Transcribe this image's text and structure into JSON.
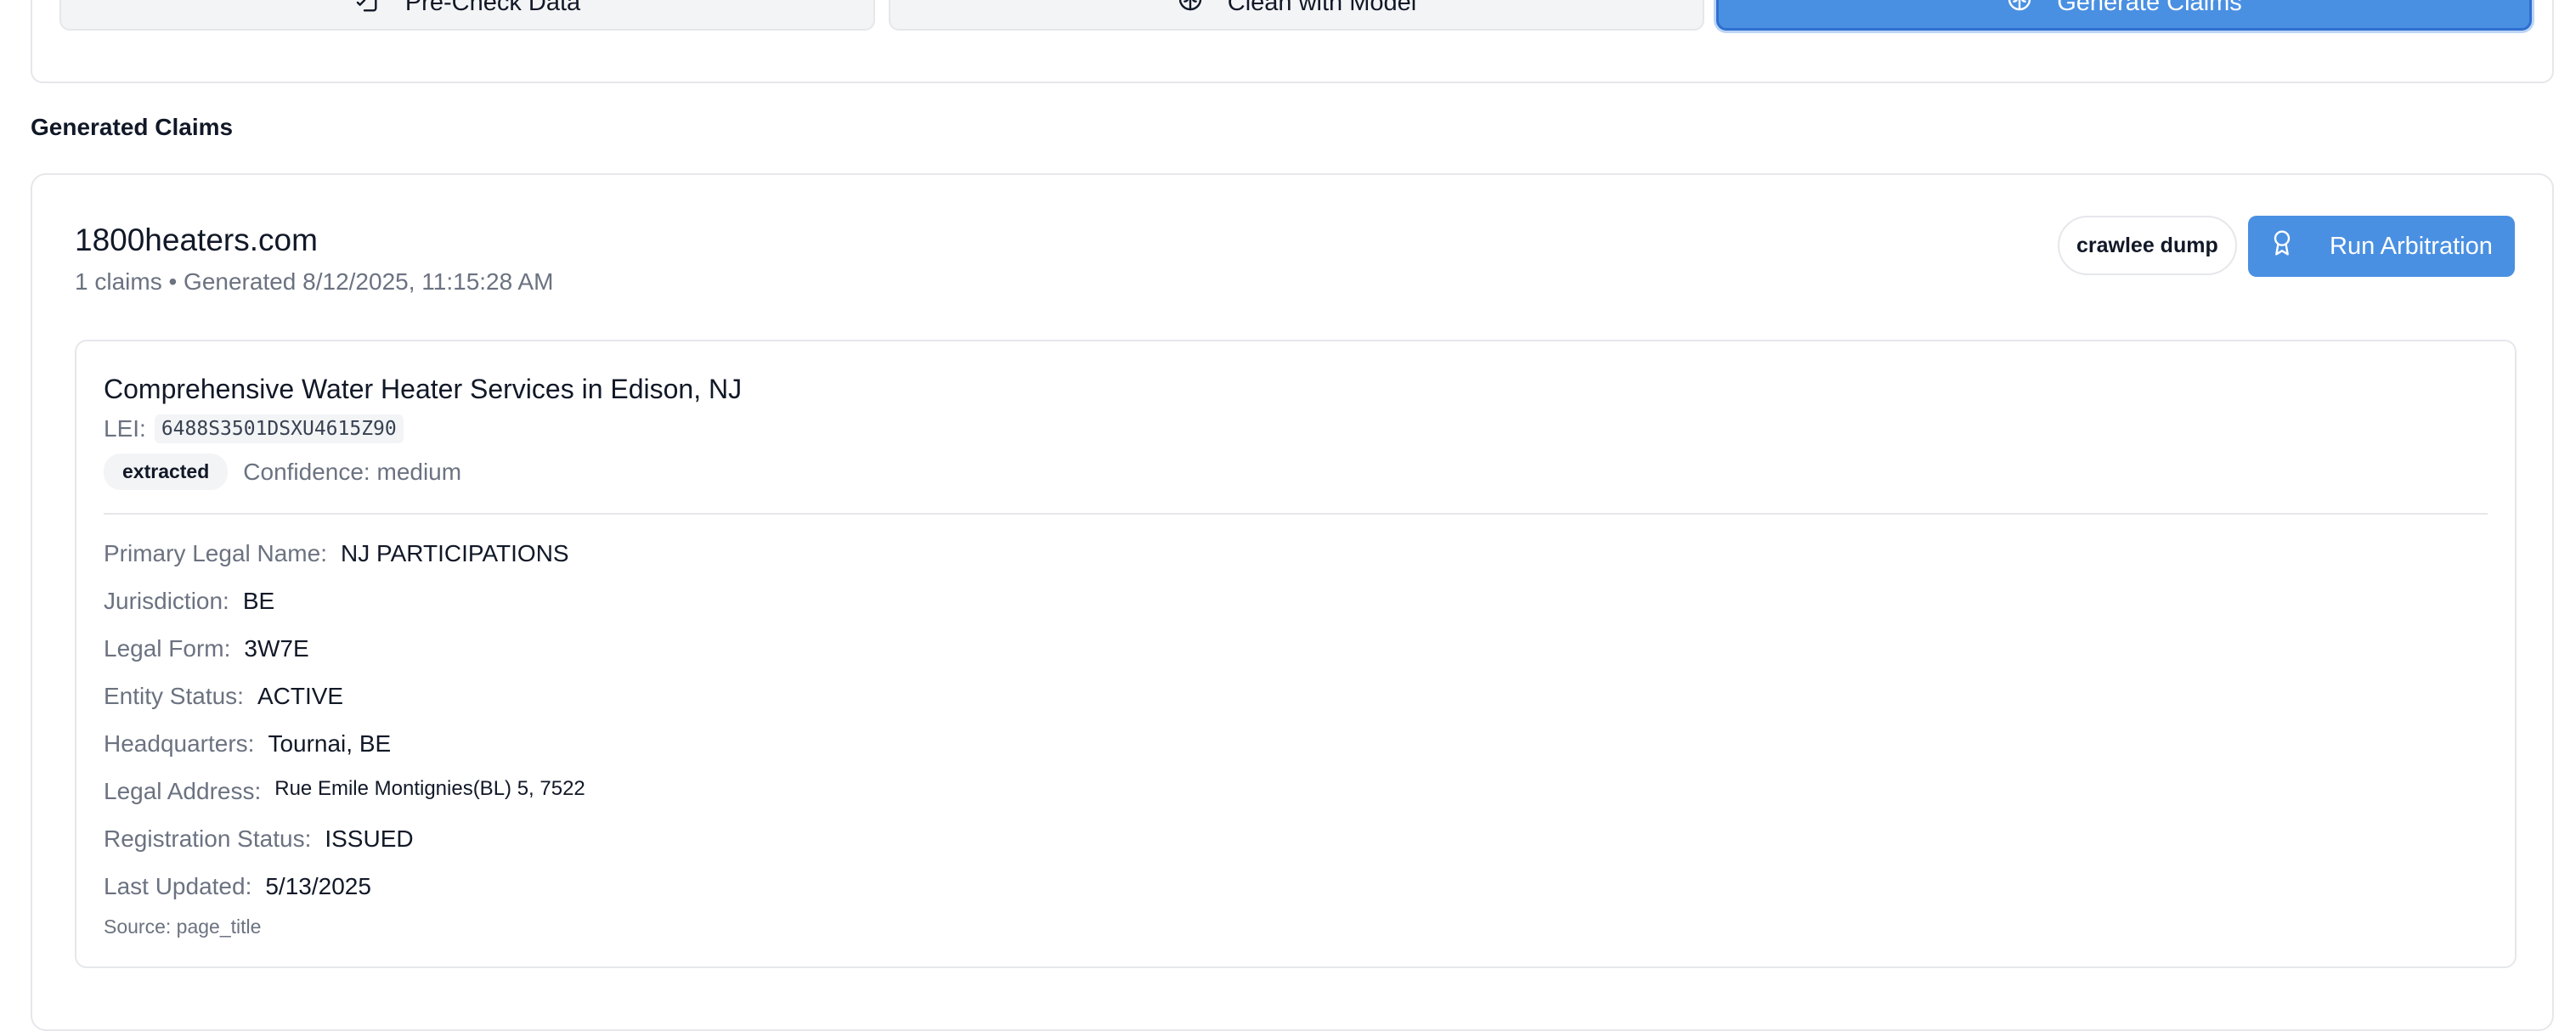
{
  "toolbar": {
    "precheck_label": "Pre-Check Data",
    "precheck_icon": "file-check-icon",
    "clean_label": "Clean with Model",
    "clean_icon": "brain-icon",
    "generate_label": "Generate Claims",
    "generate_icon": "brain-icon",
    "accent_color": "#4a90e2"
  },
  "section_title": "Generated Claims",
  "result": {
    "domain": "1800heaters.com",
    "meta": "1 claims • Generated 8/12/2025, 11:15:28 AM",
    "source_tag": "crawlee dump",
    "run_button_label": "Run Arbitration",
    "run_button_icon": "award-icon"
  },
  "claim": {
    "title": "Comprehensive Water Heater Services in Edison, NJ",
    "lei_label": "LEI:",
    "lei_value": "6488S3501DSXU4615Z90",
    "status_tag": "extracted",
    "confidence": "Confidence: medium",
    "fields": [
      {
        "label": "Primary Legal Name:",
        "value": "NJ PARTICIPATIONS"
      },
      {
        "label": "Jurisdiction:",
        "value": "BE"
      },
      {
        "label": "Legal Form:",
        "value": "3W7E"
      },
      {
        "label": "Entity Status:",
        "value": "ACTIVE"
      },
      {
        "label": "Headquarters:",
        "value": "Tournai, BE"
      },
      {
        "label": "Legal Address:",
        "value": "Rue Emile Montignies(BL) 5, 7522"
      },
      {
        "label": "Registration Status:",
        "value": "ISSUED"
      },
      {
        "label": "Last Updated:",
        "value": "5/13/2025"
      }
    ],
    "source": "Source: page_title"
  }
}
